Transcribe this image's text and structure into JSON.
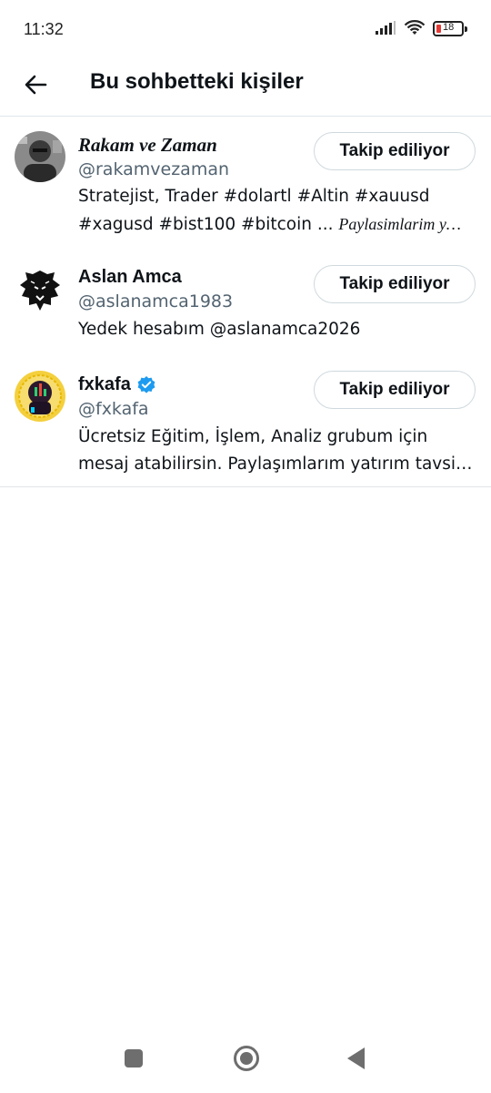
{
  "status_bar": {
    "time": "11:32",
    "battery_level": "18"
  },
  "header": {
    "title": "Bu sohbetteki kişiler",
    "back_icon": "arrow-left-icon"
  },
  "people": [
    {
      "name": "Rakam ve Zaman",
      "handle": "@rakamvezaman",
      "bio_line1": "Stratejist, Trader #dolartl #Altin #xauusd",
      "bio_line2": "#xagusd #bist100 #bitcoin ... ",
      "bio_line2_italic": "Paylasimlarim y…",
      "follow_label": "Takip ediliyor",
      "verified": false
    },
    {
      "name": "Aslan Amca",
      "handle": "@aslanamca1983",
      "bio_line1": "Yedek hesabım @aslanamca2026",
      "follow_label": "Takip ediliyor",
      "verified": false
    },
    {
      "name": "fxkafa",
      "handle": "@fxkafa",
      "bio_line1": "Ücretsiz Eğitim, İşlem, Analiz grubum için",
      "bio_line2": "mesaj atabilirsin. Paylaşımlarım yatırım tavsi…",
      "follow_label": "Takip ediliyor",
      "verified": true
    }
  ],
  "colors": {
    "verified_badge": "#1d9bf0",
    "handle_text": "#536471",
    "divider": "#e1e5e8"
  }
}
